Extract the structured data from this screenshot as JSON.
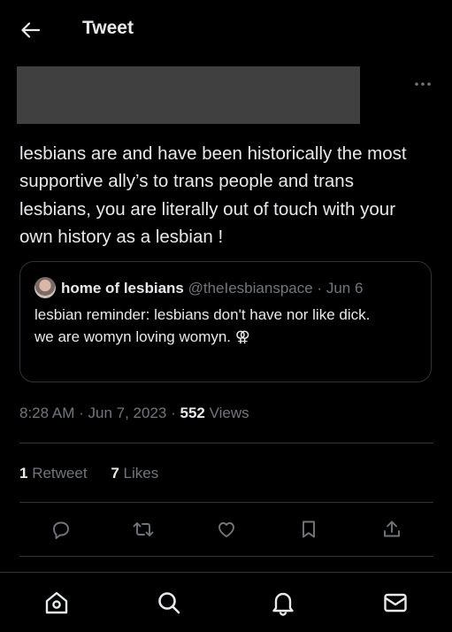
{
  "header": {
    "title": "Tweet",
    "back_icon": "arrow-left-icon"
  },
  "tweet": {
    "text": "lesbians are and have been historically the most supportive ally’s to trans people and trans lesbians, you are literally out of touch with your own history as a lesbian !",
    "time": "8:28 AM",
    "date": "Jun 7, 2023",
    "separator": "·",
    "views_count": "552",
    "views_label": "Views"
  },
  "quote": {
    "name": "home of lesbians",
    "handle": "@theIesbianspace",
    "separator": "·",
    "date": "Jun 6",
    "text_line1": "lesbian reminder: lesbians don't have nor like dick.",
    "text_line2": "we are womyn loving womyn. ⚢"
  },
  "stats": {
    "retweets_count": "1",
    "retweets_label": "Retweet",
    "likes_count": "7",
    "likes_label": "Likes"
  },
  "colors": {
    "background": "#000000",
    "text": "#e7e9ea",
    "muted": "#71767b",
    "divider": "#2f3336",
    "redacted": "#404040"
  }
}
